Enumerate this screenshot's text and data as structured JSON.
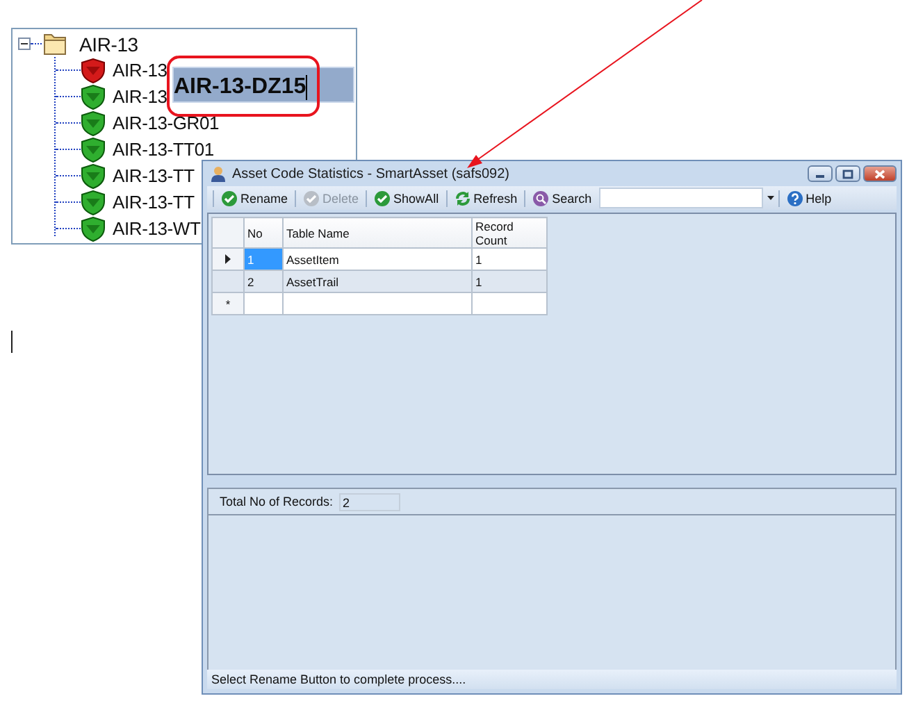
{
  "tree": {
    "root": {
      "label": "AIR-13",
      "expanded": true
    },
    "children": [
      {
        "label": "AIR-13",
        "kind": "alert"
      },
      {
        "label": "AIR-13",
        "kind": "ok"
      },
      {
        "label": "AIR-13-GR01",
        "kind": "ok"
      },
      {
        "label": "AIR-13-TT01",
        "kind": "ok"
      },
      {
        "label": "AIR-13-TT",
        "kind": "ok"
      },
      {
        "label": "AIR-13-TT",
        "kind": "ok"
      },
      {
        "label": "AIR-13-WT",
        "kind": "ok"
      }
    ]
  },
  "rename_editor": {
    "value": "AIR-13-DZ15"
  },
  "window": {
    "title": "Asset Code Statistics - SmartAsset (safs092)",
    "toolbar": [
      {
        "kind": "check",
        "label": "Rename",
        "disabled": false
      },
      {
        "kind": "check",
        "label": "Delete",
        "disabled": true
      },
      {
        "kind": "check",
        "label": "ShowAll",
        "disabled": false
      },
      {
        "kind": "refresh",
        "label": "Refresh",
        "disabled": false
      },
      {
        "kind": "search",
        "label": "Search",
        "disabled": false
      },
      {
        "kind": "combo"
      },
      {
        "kind": "help",
        "label": "Help",
        "disabled": false
      }
    ],
    "table": {
      "columns": [
        "No",
        "Table Name",
        "Record Count"
      ],
      "rows": [
        {
          "cells": [
            "1",
            "AssetItem",
            "1"
          ],
          "selected": true
        },
        {
          "cells": [
            "2",
            "AssetTrail",
            "1"
          ],
          "selected": false
        }
      ],
      "new_row_marker": "*"
    },
    "total": {
      "label": "Total No of Records:",
      "value": "2"
    },
    "status_bar": "Select Rename Button to complete process...."
  }
}
